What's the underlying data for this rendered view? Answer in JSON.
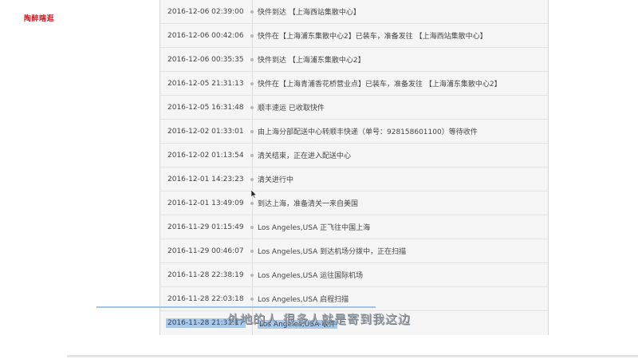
{
  "logo": {
    "text": "陶醉瞎逛"
  },
  "tracking": {
    "events": [
      {
        "time": "2016-12-06 02:39:00",
        "event": "快件到达 【上海西站集散中心】"
      },
      {
        "time": "2016-12-06 00:42:06",
        "event": "快件在【上海浦东集散中心2】已装车，准备发往 【上海西站集散中心】"
      },
      {
        "time": "2016-12-06 00:35:35",
        "event": "快件到达 【上海浦东集散中心2】"
      },
      {
        "time": "2016-12-05 21:31:13",
        "event": "快件在【上海青浦香花桥营业点】已装车，准备发往 【上海浦东集散中心2】"
      },
      {
        "time": "2016-12-05 16:31:48",
        "event": "顺丰速运 已收取快件"
      },
      {
        "time": "2016-12-02 01:33:01",
        "event": "由上海分部配送中心转顺丰快递（单号：928158601100）等待收件"
      },
      {
        "time": "2016-12-02 01:13:54",
        "event": "清关结束，正在进入配送中心"
      },
      {
        "time": "2016-12-01 14:23:23",
        "event": "清关进行中"
      },
      {
        "time": "2016-12-01 13:49:09",
        "event": "到达上海，准备清关一来自美国"
      },
      {
        "time": "2016-11-29 01:15:49",
        "event": "Los Angeles,USA 正飞往中国上海"
      },
      {
        "time": "2016-11-29 00:46:07",
        "event": "Los Angeles,USA 到达机场分拨中，正在扫描"
      },
      {
        "time": "2016-11-28 22:38:19",
        "event": "Los Angeles,USA 运往国际机场"
      },
      {
        "time": "2016-11-28 22:03:18",
        "event": "Los Angeles,USA 启程扫描"
      },
      {
        "time": "2016-11-28 21:31:17",
        "event": "Los Angeles,USA 收件"
      }
    ]
  },
  "subtitle": {
    "text": "外地的人 很多人就是寄到我这边"
  },
  "colors": {
    "panel_bg": "#f5f5f5",
    "row_border": "#e2e2e2",
    "text": "#444444",
    "highlight": "#a9c9ea",
    "logo": "#c8202a"
  }
}
